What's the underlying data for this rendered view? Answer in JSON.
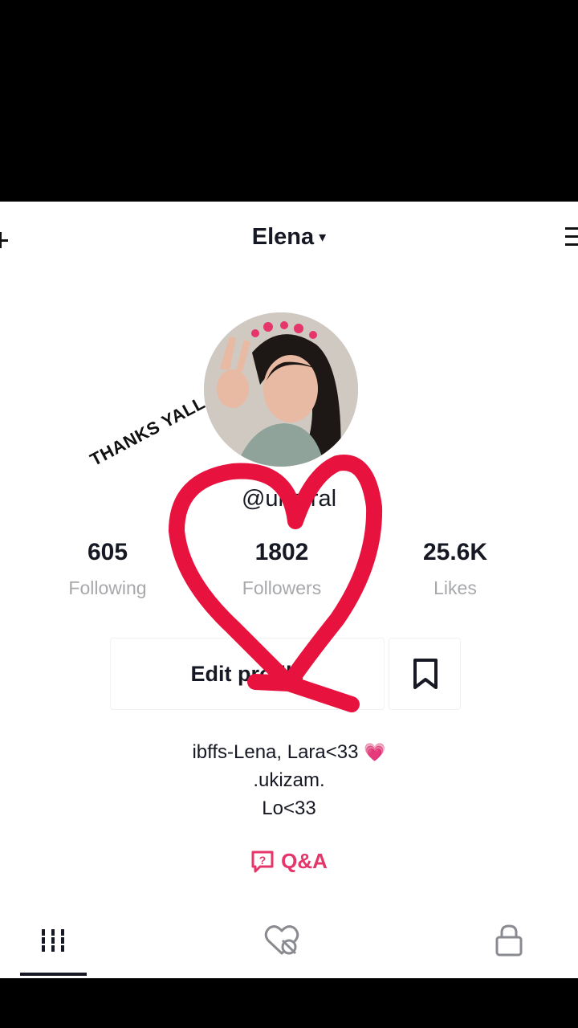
{
  "header": {
    "title": "Elena",
    "caret": "▾",
    "add_icon": "add-icon",
    "menu_icon": "menu-icon"
  },
  "profile": {
    "handle": "@una   ral",
    "sticker_text": "THANKS YALL",
    "avatar": "avatar-photo"
  },
  "stats": [
    {
      "value": "605",
      "label": "Following"
    },
    {
      "value": "1802",
      "label": "Followers"
    },
    {
      "value": "25.6K",
      "label": "Likes"
    }
  ],
  "actions": {
    "edit_label": "Edit profile",
    "bookmark_icon": "bookmark-icon"
  },
  "bio": {
    "line1": "ibffs-Lena, Lara<33",
    "line1_emoji": "💗",
    "line2": ".ukizam.",
    "line3": "Lo<33"
  },
  "qa": {
    "label": "Q&A",
    "icon": "qa-icon"
  },
  "tabs": [
    {
      "icon": "grid-icon",
      "active": true
    },
    {
      "icon": "liked-hidden-icon",
      "active": false
    },
    {
      "icon": "lock-icon",
      "active": false
    }
  ],
  "colors": {
    "accent": "#e5356a",
    "text": "#161823",
    "muted": "#a7a8ac",
    "drawn_heart": "#e8123f"
  }
}
